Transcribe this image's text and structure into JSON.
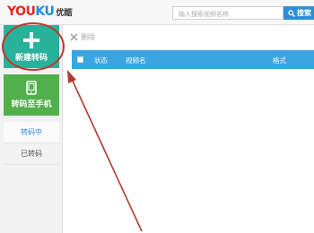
{
  "header": {
    "logo_cn": "优酷",
    "search_placeholder": "输入搜索视频名称",
    "search_button": "搜索"
  },
  "sidebar": {
    "new_transcode": "新建转码",
    "transcode_to_phone": "转码至手机",
    "items": [
      {
        "label": "转码中",
        "active": true
      },
      {
        "label": "已转码",
        "active": false
      }
    ]
  },
  "toolbar": {
    "delete_label": "删除"
  },
  "table": {
    "columns": [
      "状态",
      "视频名",
      "格式"
    ]
  },
  "colors": {
    "accent_blue": "#2c8ed8",
    "new_button": "#2ab19b",
    "phone_button": "#51b04b",
    "annotation": "#c0392b"
  }
}
